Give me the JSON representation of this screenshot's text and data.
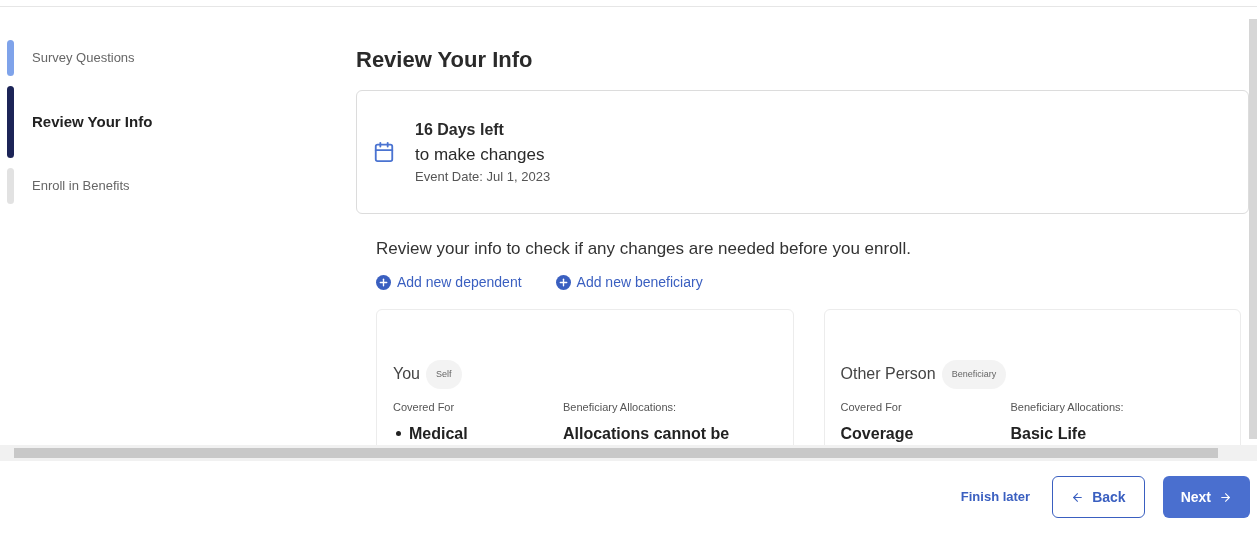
{
  "steps": [
    {
      "label": "Survey Questions",
      "kind": "complete",
      "selected": false
    },
    {
      "label": "Review Your Info",
      "kind": "current",
      "selected": true
    },
    {
      "label": "Enroll in Benefits",
      "kind": "upcoming",
      "selected": false
    }
  ],
  "page_title": "Review Your Info",
  "deadline": {
    "days": "16 Days left",
    "subtitle": "to make changes",
    "event_date": "Event Date: Jul 1, 2023"
  },
  "intro": "Review your info to check if any changes are needed before you enroll.",
  "actions": [
    "Add new dependent",
    "Add new beneficiary"
  ],
  "people": [
    {
      "name": "You",
      "tag": "Self",
      "fields": [
        {
          "label": "Covered For",
          "value": "Medical",
          "kind": "list"
        },
        {
          "label": "Beneficiary Allocations:",
          "value": "Allocations cannot be",
          "kind": "text"
        }
      ]
    },
    {
      "name": "Other Person",
      "tag": "Beneficiary",
      "fields": [
        {
          "label": "Covered For",
          "value": "Coverage",
          "kind": "text"
        },
        {
          "label": "Beneficiary Allocations:",
          "value": "Basic Life",
          "kind": "text"
        }
      ]
    }
  ],
  "footer": {
    "finish_later": "Finish later",
    "back": "Back",
    "next": "Next"
  }
}
